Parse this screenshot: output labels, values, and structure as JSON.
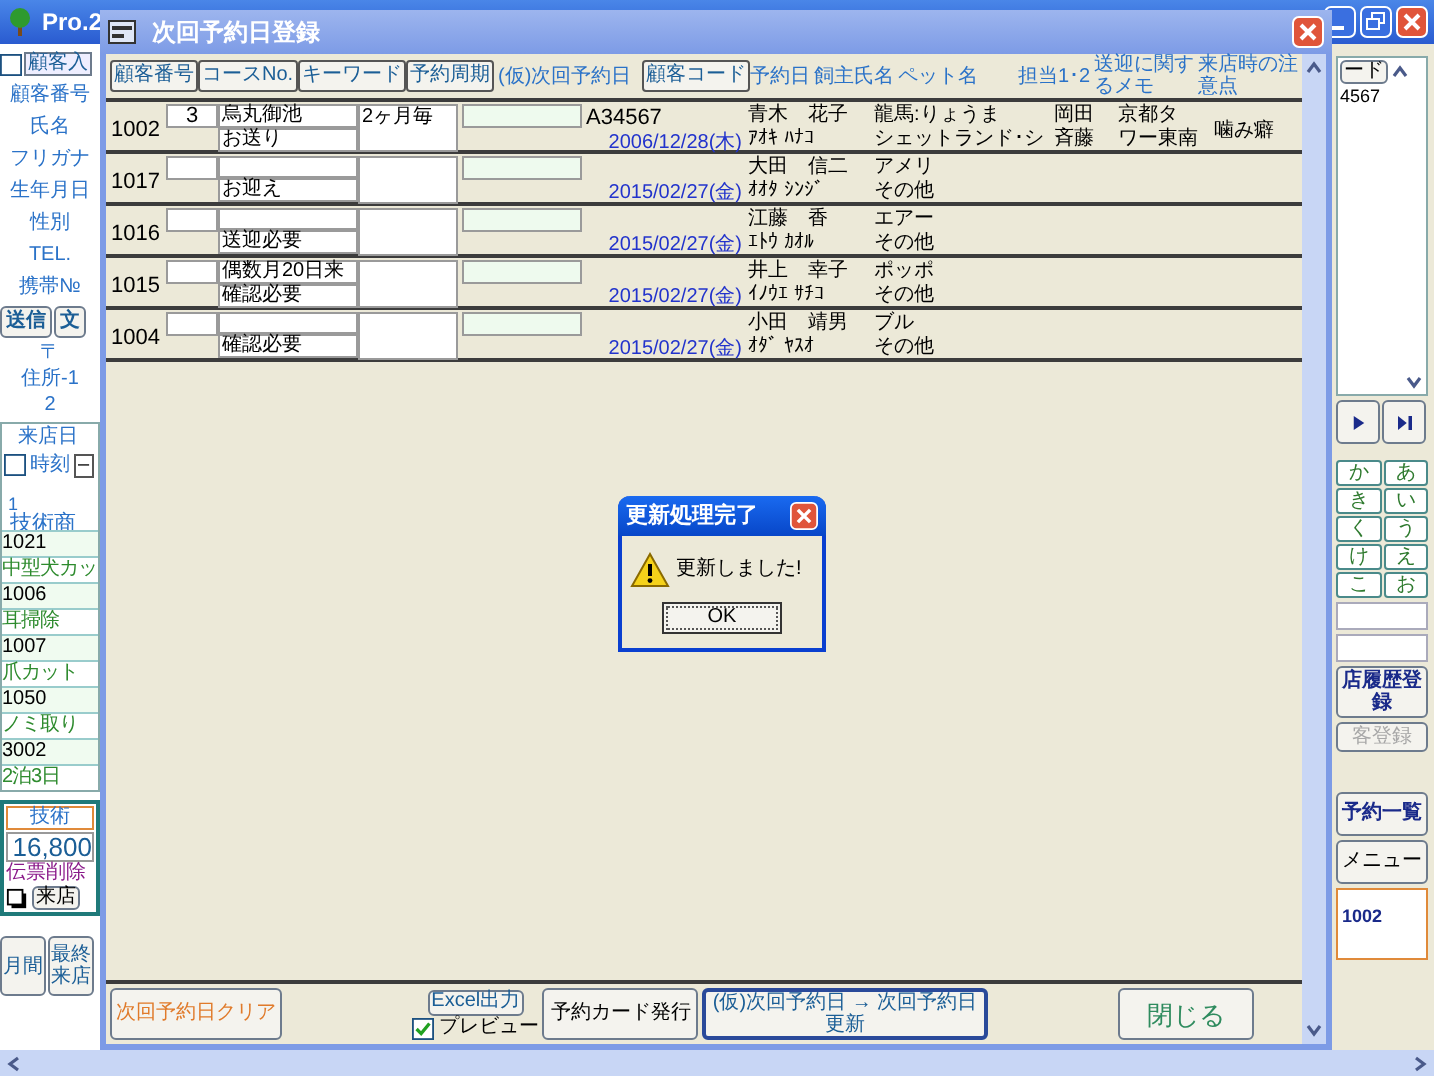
{
  "app": {
    "title": "Pro.2"
  },
  "left_panel": {
    "input_checked": false,
    "input_button": "顧客入",
    "labels": [
      "顧客番号",
      "氏名",
      "フリガナ",
      "生年月日",
      "性別",
      "TEL.",
      "携帯№"
    ],
    "buttons": [
      "送信",
      "文"
    ],
    "address_labels": [
      "〒",
      "住所-1",
      "2"
    ],
    "visit": {
      "label": "来店日",
      "button": "–",
      "checked": false,
      "time_label": "時刻",
      "number": "1",
      "section_title": "技術商"
    },
    "items": [
      {
        "code": "1021",
        "name": "中型犬カッ"
      },
      {
        "code": "1006",
        "name": "耳掃除"
      },
      {
        "code": "1007",
        "name": "爪カット"
      },
      {
        "code": "1050",
        "name": "ノミ取り"
      },
      {
        "code": "3002",
        "name": "2泊3日"
      }
    ],
    "total": {
      "label": "技術",
      "amount": "16,800",
      "delete_label": "伝票削除",
      "visit_button": "来店"
    },
    "bottom_buttons": [
      "月間",
      "最終来店"
    ]
  },
  "right_panel": {
    "code_button": "ード",
    "code_value": "4567",
    "kana": [
      "か",
      "あ",
      "き",
      "い",
      "く",
      "う",
      "け",
      "え",
      "こ",
      "お"
    ],
    "buttons": [
      {
        "label": "店履歴登録",
        "disabled": false
      },
      {
        "label": "客登録",
        "disabled": true
      }
    ],
    "list_button": "予約一覧",
    "menu_button": "メニュー",
    "card_number": "1002"
  },
  "dialog": {
    "title": "次回予約日登録",
    "header": [
      {
        "kind": "button",
        "label": "顧客番号"
      },
      {
        "kind": "button",
        "label": "コースNo."
      },
      {
        "kind": "button",
        "label": "キーワード"
      },
      {
        "kind": "button",
        "label": "予約周期"
      },
      {
        "kind": "label",
        "label": "(仮)次回予約日"
      },
      {
        "kind": "button",
        "label": "顧客コード"
      },
      {
        "kind": "label",
        "label": "予約日"
      },
      {
        "kind": "label",
        "label": "飼主氏名"
      },
      {
        "kind": "label",
        "label": "ペット名"
      },
      {
        "kind": "label",
        "label": "担当1･2"
      },
      {
        "kind": "label",
        "label": "送迎に関するメモ"
      },
      {
        "kind": "label",
        "label": "来店時の注意点"
      }
    ],
    "rows": [
      {
        "number": "1002",
        "course": "3",
        "keyword": "烏丸御池",
        "keyword_2": "お送り",
        "cycle": "2ヶ月毎",
        "code": "A34567",
        "date": "2006/12/28(木)",
        "owner": "青木　花子",
        "owner_kana": "ｱｵｷ ﾊﾅｺ",
        "pet": "龍馬:りょうま",
        "pet_type": "シェットランド･シ",
        "staff_1": "岡田",
        "staff_2": "斉藤",
        "memo": "京都タ",
        "memo_2": "ワー東南",
        "note": "噛み癖"
      },
      {
        "number": "1017",
        "keyword_2": "お迎え",
        "date": "2015/02/27(金)",
        "owner": "大田　信二",
        "owner_kana": "ｵｵﾀ ｼﾝｼﾞ",
        "pet": "アメリ",
        "pet_type": "その他"
      },
      {
        "number": "1016",
        "keyword_2": "送迎必要",
        "date": "2015/02/27(金)",
        "owner": "江藤　香",
        "owner_kana": "ｴﾄｳ ｶｵﾙ",
        "pet": "エアー",
        "pet_type": "その他"
      },
      {
        "number": "1015",
        "keyword": "偶数月20日来",
        "keyword_2": "確認必要",
        "date": "2015/02/27(金)",
        "owner": "井上　幸子",
        "owner_kana": "ｲﾉｳｴ ｻﾁｺ",
        "pet": "ポッポ",
        "pet_type": "その他"
      },
      {
        "number": "1004",
        "keyword_2": "確認必要",
        "date": "2015/02/27(金)",
        "owner": "小田　靖男",
        "owner_kana": "ｵﾀﾞ ﾔｽｵ",
        "pet": "ブル",
        "pet_type": "その他"
      }
    ],
    "footer": {
      "clear_button": "次回予約日クリア",
      "excel_button": "Excel出力",
      "preview": {
        "label": "プレビュー",
        "checked": true
      },
      "card_button": "予約カード発行",
      "update_button": "(仮)次回予約日 → 次回予約日",
      "update_button_2": "更新",
      "close_button": "閉じる"
    }
  },
  "message_box": {
    "title": "更新処理完了",
    "message": "更新しました!",
    "button": "OK"
  }
}
